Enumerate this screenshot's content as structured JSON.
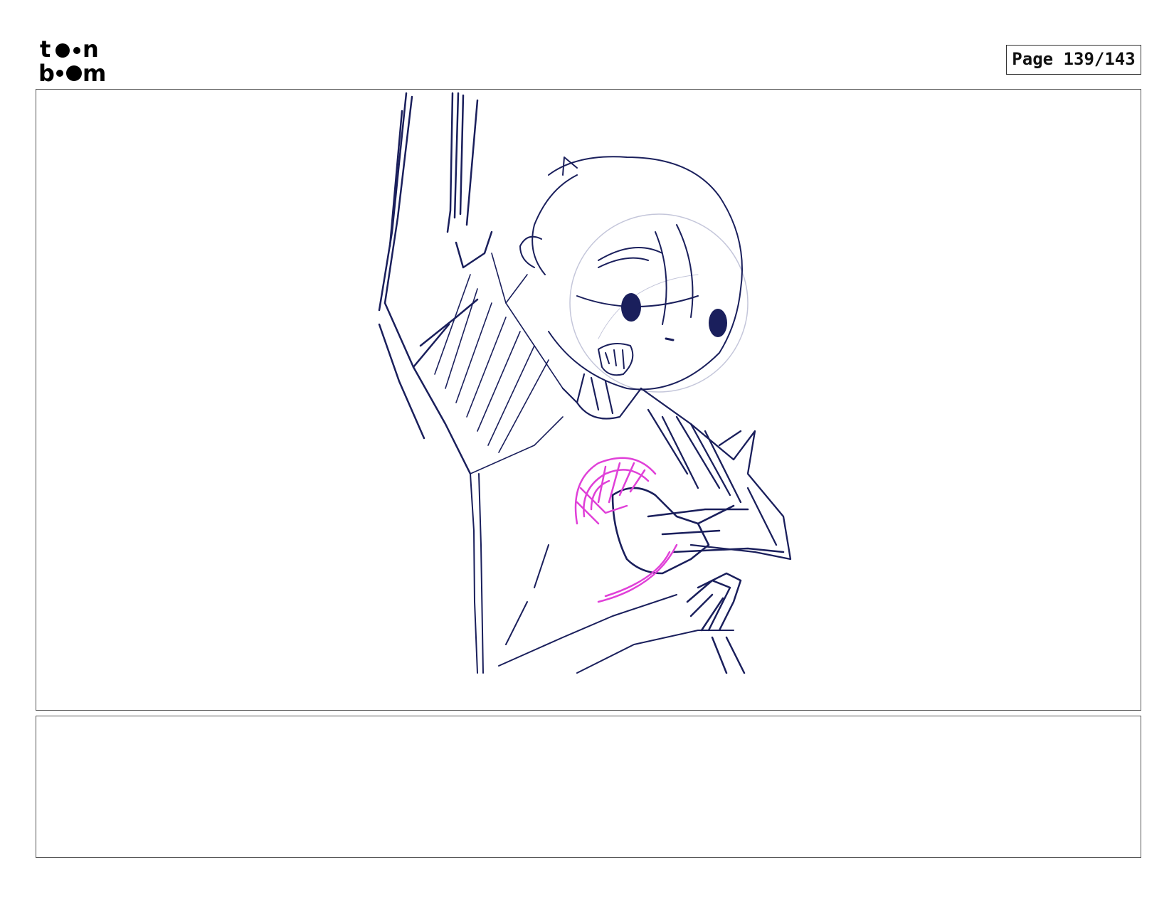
{
  "header": {
    "logo": {
      "line1": "toon",
      "line2": "boom"
    },
    "page_counter": "Page 139/143"
  },
  "panel": {
    "sketch_colors": {
      "ink": "#1a1f5c",
      "accent": "#e040d8",
      "guide": "#b8bad0"
    }
  },
  "notes": {
    "text": ""
  }
}
